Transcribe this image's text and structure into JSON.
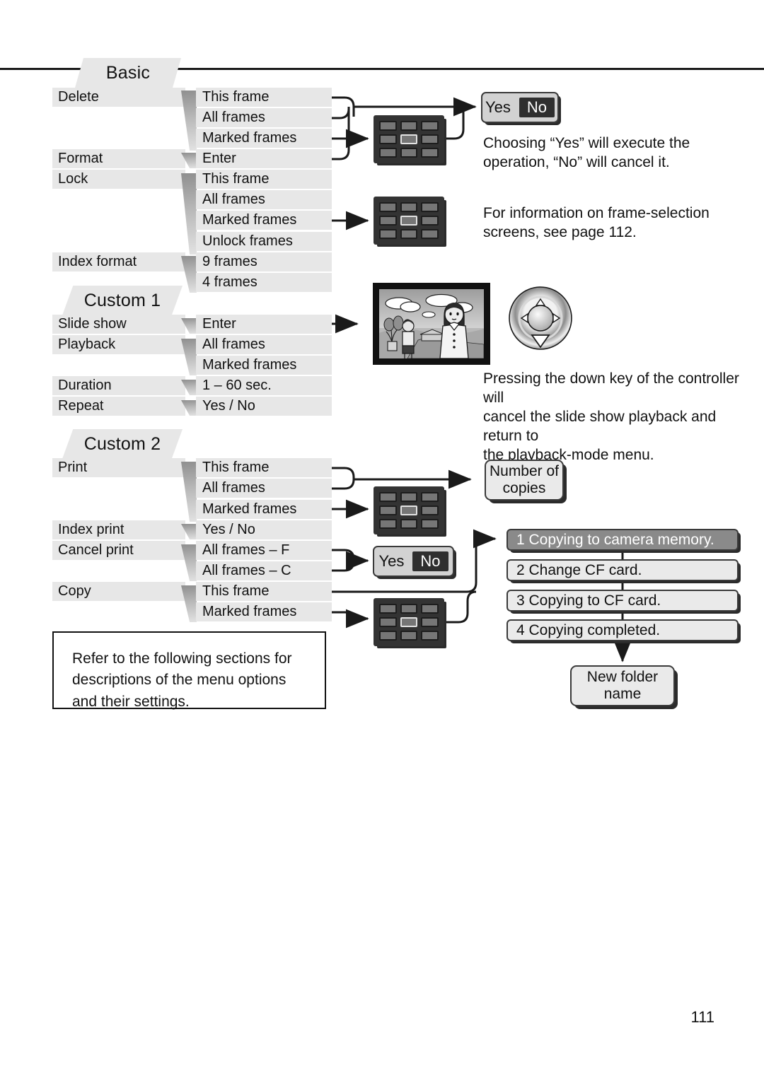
{
  "page_number": "111",
  "sections": [
    {
      "id": "basic",
      "tab_label": "Basic",
      "items": [
        {
          "label": "Delete",
          "options": [
            "This frame",
            "All frames",
            "Marked frames"
          ]
        },
        {
          "label": "Format",
          "options": [
            "Enter"
          ]
        },
        {
          "label": "Lock",
          "options": [
            "This frame",
            "All frames",
            "Marked frames",
            "Unlock frames"
          ]
        },
        {
          "label": "Index format",
          "options": [
            "9 frames",
            "4 frames"
          ]
        }
      ]
    },
    {
      "id": "custom1",
      "tab_label": "Custom 1",
      "items": [
        {
          "label": "Slide show",
          "options": [
            "Enter"
          ]
        },
        {
          "label": "Playback",
          "options": [
            "All frames",
            "Marked frames"
          ]
        },
        {
          "label": "Duration",
          "options": [
            "1 – 60 sec."
          ]
        },
        {
          "label": "Repeat",
          "options": [
            "Yes / No"
          ]
        }
      ]
    },
    {
      "id": "custom2",
      "tab_label": "Custom 2",
      "items": [
        {
          "label": "Print",
          "options": [
            "This frame",
            "All frames",
            "Marked frames"
          ]
        },
        {
          "label": "Index print",
          "options": [
            "Yes / No"
          ]
        },
        {
          "label": "Cancel print",
          "options": [
            "All frames – F",
            "All frames – C"
          ]
        },
        {
          "label": "Copy",
          "options": [
            "This frame",
            "Marked frames"
          ]
        }
      ]
    }
  ],
  "dialogs": {
    "confirm_yes": "Yes",
    "confirm_no": "No",
    "number_of_copies": "Number of\ncopies",
    "number_of_copies_line1": "Number of",
    "number_of_copies_line2": "copies",
    "new_folder_line1": "New folder",
    "new_folder_line2": "name"
  },
  "copy_steps": [
    {
      "text": "1 Copying to camera memory.",
      "active": true
    },
    {
      "text": "2 Change CF card.",
      "active": false
    },
    {
      "text": "3 Copying to CF card.",
      "active": false
    },
    {
      "text": "4 Copying completed.",
      "active": false
    }
  ],
  "annotations": {
    "confirm_note_line1": "Choosing “Yes” will execute the",
    "confirm_note_line2": "operation, “No” will cancel it.",
    "frameselect_note_line1": "For information on frame-selection",
    "frameselect_note_line2": "screens, see page 112.",
    "slideshow_note_line1": "Pressing the down key of the controller will",
    "slideshow_note_line2": "cancel the slide show playback and return to",
    "slideshow_note_line3": "the playback-mode menu."
  },
  "callout": {
    "line1": "Refer to the following sections for",
    "line2": "descriptions of the menu options",
    "line3": "and their settings."
  },
  "icons": {
    "frame_selection_grid": "grid-9-frames-icon",
    "controller": "four-way-controller-icon",
    "sample_image": "sample-photo-icon"
  },
  "colors": {
    "row_bg": "#e7e7e7",
    "tab_bg": "#e7e7e7",
    "box_bg": "#d2d2d2",
    "status_active_bg": "#8a8a8a",
    "status_bg": "#eaeaea",
    "ink": "#111111",
    "grid_bg": "#333333",
    "grid_cell": "#767676"
  }
}
